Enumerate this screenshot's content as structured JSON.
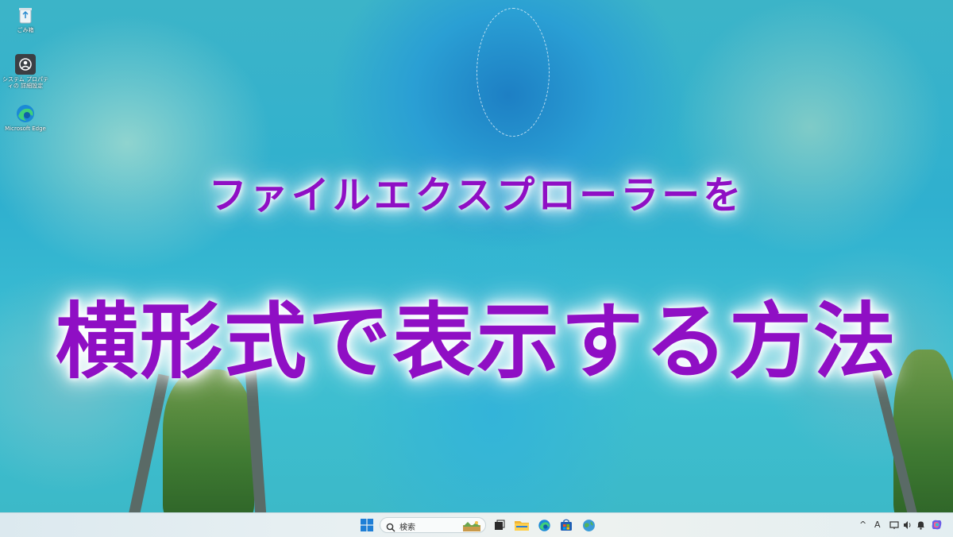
{
  "desktop": {
    "icons": [
      {
        "label": "ごみ箱",
        "icon": "recycle-bin-icon"
      },
      {
        "label": "システム プロパティの 詳細設定",
        "icon": "system-properties-icon"
      },
      {
        "label": "Microsoft Edge",
        "icon": "edge-icon"
      }
    ]
  },
  "overlay": {
    "line1": "ファイルエクスプローラーを",
    "line2": "横形式で表示する方法"
  },
  "taskbar": {
    "search_label": "検索",
    "items": [
      "windows-start-icon",
      "search-icon",
      "widget-landscape-icon",
      "task-view-icon",
      "file-explorer-icon",
      "edge-icon",
      "microsoft-store-icon",
      "globe-app-icon"
    ],
    "tray": {
      "chevron": "^",
      "ime": "A",
      "icons": [
        "network-icon",
        "volume-icon",
        "notification-bell-icon",
        "copilot-icon"
      ]
    }
  },
  "colors": {
    "title": "#8f0fc4",
    "glow": "#ffffff"
  }
}
